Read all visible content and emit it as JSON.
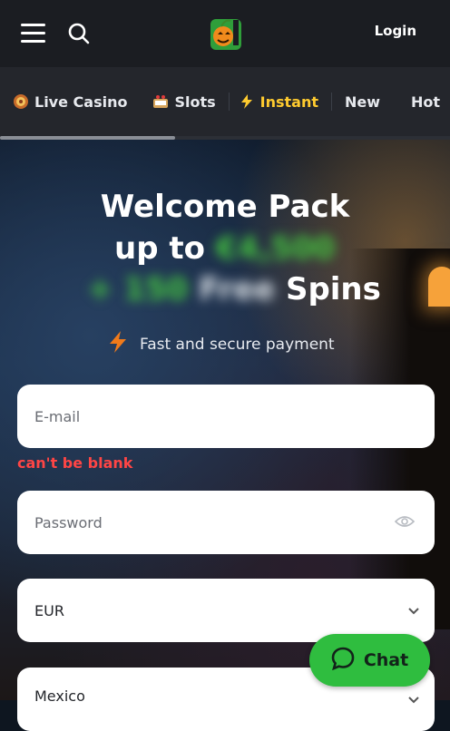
{
  "header": {
    "login_label": "Login"
  },
  "categories": [
    {
      "label": "Live Casino",
      "icon": "roulette-icon",
      "active": false
    },
    {
      "label": "Slots",
      "icon": "slot-machine-icon",
      "active": false
    },
    {
      "label": "Instant",
      "icon": "lightning-icon",
      "active": true
    },
    {
      "label": "New",
      "icon": "",
      "active": false
    },
    {
      "label": "Hot",
      "icon": "",
      "active": false
    }
  ],
  "hero": {
    "title_line1": "Welcome Pack",
    "title_line2_prefix": "up to",
    "title_line2_blurred": "€4,500",
    "title_line3_blurred_a": "+",
    "title_line3_blurred_b": "150",
    "title_line3_blurred_c": "Free",
    "title_line3_suffix": "Spins",
    "payment_text": "Fast and secure payment"
  },
  "form": {
    "email_placeholder": "E-mail",
    "email_error": "can't be blank",
    "password_placeholder": "Password",
    "currency_value": "EUR",
    "country_value": "Mexico"
  },
  "chat": {
    "label": "Chat"
  },
  "colors": {
    "accent_yellow": "#ffcb2f",
    "error_red": "#ff4545",
    "chat_green": "#2fbd3f"
  }
}
